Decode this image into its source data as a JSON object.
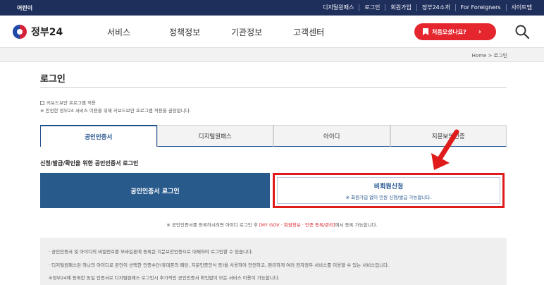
{
  "topbar": {
    "left_label": "어린이",
    "links": [
      "디지털원패스",
      "로그인",
      "회원가입",
      "정부24소개",
      "For Foreigners",
      "사이트맵"
    ]
  },
  "header": {
    "logo_text": "정부24",
    "nav": [
      "서비스",
      "정책정보",
      "기관정보",
      "고객센터"
    ],
    "first_visit_label": "처음오셨나요?",
    "icons": [
      "bookmark-icon",
      "chevron-right-icon",
      "search-icon"
    ]
  },
  "breadcrumb": {
    "home": "Home",
    "separator": ">",
    "current": "로그인"
  },
  "page": {
    "title": "로그인"
  },
  "keyboard": {
    "checkbox_label": "키보드보안 프로그램 적용",
    "notice": "※ 안전한 정부24 서비스 이용을 위해 키보드보안 프로그램 적용을 권장합니다."
  },
  "tabs": [
    "공인인증서",
    "디지털원패스",
    "아이디",
    "지문보안인증"
  ],
  "login": {
    "subtitle": "신청/발급/확인을 위한 공인인증서 로그인",
    "cert_button": "공인인증서 로그인",
    "guest_title": "비회원신청",
    "guest_desc": "※ 회원가입 없이 민원 신청/발급 가능합니다."
  },
  "note": {
    "before": "※ 공인인증서를 등록하시려면 아이디 로그인 후 ",
    "highlight": "[MY GOV · 회원정보 · 인증 등록/관리]",
    "after": "에서 등록 가능합니다."
  },
  "info": [
    "· 공인인증서 및 아이디의 비밀번호를 모바일폰에 등록된 지문보안인증으로 대체하여 로그인할 수 있습니다.",
    "· 디지털원패스란 하나의 아이디로 본인이 선택한 인증수단(휴대폰의 패턴, 지문인증인식 등)을 사용하여 안전하고, 편리하게 여러 전자정부 서비스를 이용할 수 있는 서비스입니다.",
    "※정부24에 등록한 동일 인증서로 디지털원패스 로그인시 추가적인 공인인증서 확인없이 모든 서비스 이용이 가능합니다."
  ],
  "colors": {
    "topbar": "#1f2f5c",
    "accent_red": "#e5262f",
    "cert_button": "#295a8c",
    "guest_border": "#e01b1b",
    "link_blue": "#1e4f8c"
  }
}
